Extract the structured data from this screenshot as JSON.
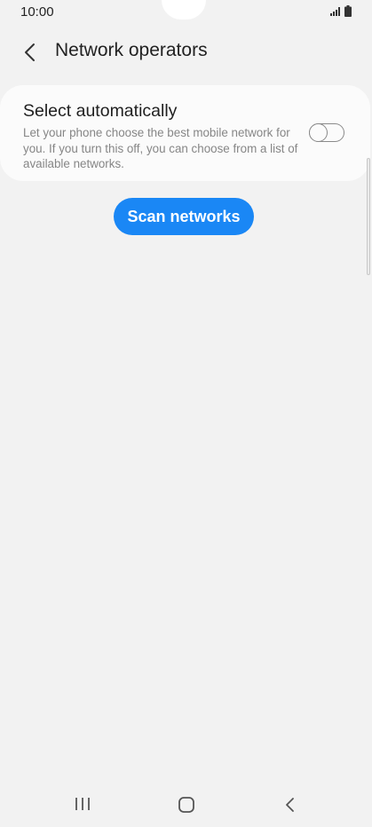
{
  "status_bar": {
    "time": "10:00",
    "icons": [
      "signal-icon",
      "battery-icon"
    ]
  },
  "header": {
    "title": "Network operators",
    "back_icon": "chevron-left-icon"
  },
  "settings": {
    "select_automatically": {
      "title": "Select automatically",
      "description": "Let your phone choose the best mobile network for you. If you turn this off, you can choose from a list of available networks.",
      "toggle_state": "off"
    }
  },
  "actions": {
    "scan_label": "Scan networks"
  },
  "nav_bar": {
    "icons": [
      "recent-apps-icon",
      "home-icon",
      "back-icon"
    ]
  },
  "colors": {
    "background": "#f2f2f2",
    "card": "#fbfbfb",
    "accent": "#1a87f5",
    "secondary_text": "#868686"
  }
}
